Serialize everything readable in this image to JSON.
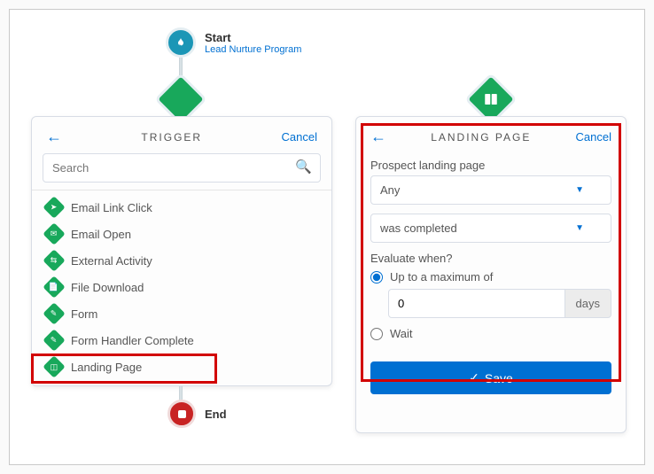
{
  "start": {
    "title": "Start",
    "subtitle": "Lead Nurture Program"
  },
  "left_panel": {
    "title": "Trigger",
    "cancel": "Cancel",
    "search_placeholder": "Search",
    "items": [
      {
        "label": "Email Link Click",
        "icon": "cursor"
      },
      {
        "label": "Email Open",
        "icon": "envelope"
      },
      {
        "label": "External Activity",
        "icon": "swap"
      },
      {
        "label": "File Download",
        "icon": "file"
      },
      {
        "label": "Form",
        "icon": "form"
      },
      {
        "label": "Form Handler Complete",
        "icon": "form"
      },
      {
        "label": "Landing Page",
        "icon": "page"
      }
    ]
  },
  "end": {
    "label": "End"
  },
  "right_panel": {
    "title": "Landing Page",
    "cancel": "Cancel",
    "field1_label": "Prospect landing page",
    "select1_value": "Any",
    "select2_value": "was completed",
    "eval_label": "Evaluate when?",
    "radio1_label": "Up to a maximum of",
    "num_value": "0",
    "num_suffix": "days",
    "radio2_label": "Wait",
    "save_label": "Save"
  }
}
